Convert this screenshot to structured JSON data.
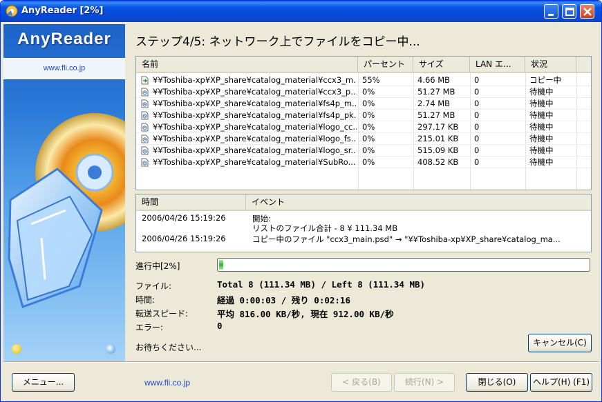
{
  "window": {
    "title": "AnyReader [2%]"
  },
  "banner": {
    "brand": "AnyReader",
    "url": "www.fli.co.jp"
  },
  "step_title": "ステップ4/5: ネットワーク上でファイルをコピー中...",
  "file_list": {
    "columns": [
      "名前",
      "パーセント",
      "サイズ",
      "LAN エ...",
      "状況"
    ],
    "rows": [
      {
        "name": "¥¥Toshiba-xp¥XP_share¥catalog_material¥ccx3_m...",
        "percent": "55%",
        "size": "4.66 MB",
        "lan": "0",
        "status": "コピー中",
        "icon": "copying-file-icon"
      },
      {
        "name": "¥¥Toshiba-xp¥XP_share¥catalog_material¥ccx3_p...",
        "percent": "0%",
        "size": "51.27 MB",
        "lan": "0",
        "status": "待機中",
        "icon": "waiting-file-icon"
      },
      {
        "name": "¥¥Toshiba-xp¥XP_share¥catalog_material¥fs4p_m...",
        "percent": "0%",
        "size": "2.74 MB",
        "lan": "0",
        "status": "待機中",
        "icon": "waiting-file-icon"
      },
      {
        "name": "¥¥Toshiba-xp¥XP_share¥catalog_material¥fs4p_pk...",
        "percent": "0%",
        "size": "51.27 MB",
        "lan": "0",
        "status": "待機中",
        "icon": "waiting-file-icon"
      },
      {
        "name": "¥¥Toshiba-xp¥XP_share¥catalog_material¥logo_cc...",
        "percent": "0%",
        "size": "297.17 KB",
        "lan": "0",
        "status": "待機中",
        "icon": "waiting-file-icon"
      },
      {
        "name": "¥¥Toshiba-xp¥XP_share¥catalog_material¥logo_fs...",
        "percent": "0%",
        "size": "215.01 KB",
        "lan": "0",
        "status": "待機中",
        "icon": "waiting-file-icon"
      },
      {
        "name": "¥¥Toshiba-xp¥XP_share¥catalog_material¥logo_sr...",
        "percent": "0%",
        "size": "515.09 KB",
        "lan": "0",
        "status": "待機中",
        "icon": "waiting-file-icon"
      },
      {
        "name": "¥¥Toshiba-xp¥XP_share¥catalog_material¥SubRo...",
        "percent": "0%",
        "size": "408.52 KB",
        "lan": "0",
        "status": "待機中",
        "icon": "waiting-file-icon"
      }
    ]
  },
  "events": {
    "columns": [
      "時間",
      "イベント"
    ],
    "rows": [
      {
        "time": "2006/04/26 15:19:26",
        "lines": [
          "開始:",
          "リストのファイル合計 - 8 ¥ 111.34 MB"
        ]
      },
      {
        "time": "2006/04/26 15:19:26",
        "lines": [
          "コピー中のファイル \"ccx3_main.psd\" → \"¥¥Toshiba-xp¥XP_share¥catalog_ma..."
        ]
      }
    ]
  },
  "progress": {
    "label": "進行中[2%]",
    "fraction": 0.02,
    "file_label": "ファイル:",
    "file_value": "Total 8 (111.34 MB) / Left 8 (111.34 MB)",
    "time_label": "時間:",
    "time_value": "経過 0:00:03 / 残り 0:02:16",
    "speed_label": "転送スピード:",
    "speed_value": "平均 816.00 KB/秒, 現在 912.00 KB/秒",
    "error_label": "エラー:",
    "error_value": "0",
    "waiting": "お待ちください..."
  },
  "buttons": {
    "cancel": "キャンセル(C)",
    "menu": "メニュー...",
    "back": "< 戻る(B)",
    "next": "続行(N) >",
    "close": "閉じる(O)",
    "help": "ヘルプ(H) (F1)"
  },
  "footer": {
    "url": "www.fli.co.jp"
  },
  "colors": {
    "title_bar": "#0649d8",
    "banner": "#2b79d8",
    "progress_fill": "#2fb52a",
    "link": "#1f48c8"
  }
}
